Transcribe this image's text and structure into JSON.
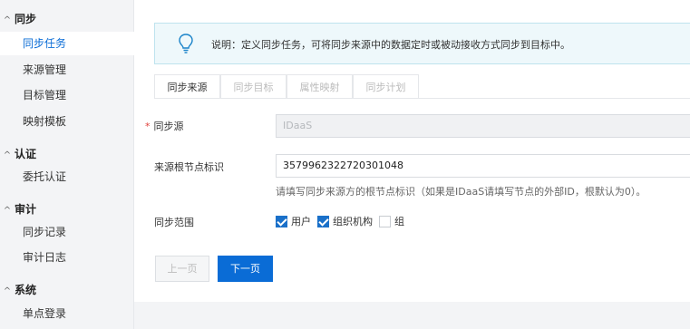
{
  "sidebar": {
    "groups": [
      {
        "title": "同步",
        "items": [
          {
            "label": "同步任务",
            "active": true
          },
          {
            "label": "来源管理"
          },
          {
            "label": "目标管理"
          },
          {
            "label": "映射模板"
          }
        ]
      },
      {
        "title": "认证",
        "items": [
          {
            "label": "委托认证"
          }
        ]
      },
      {
        "title": "审计",
        "items": [
          {
            "label": "同步记录"
          },
          {
            "label": "审计日志"
          }
        ]
      },
      {
        "title": "系统",
        "items": [
          {
            "label": "单点登录"
          }
        ]
      }
    ],
    "caret_icon": "^"
  },
  "notice": {
    "icon": "lightbulb-icon",
    "text": "说明：定义同步任务，可将同步来源中的数据定时或被动接收方式同步到目标中。"
  },
  "tabs": [
    {
      "label": "同步来源",
      "active": true
    },
    {
      "label": "同步目标"
    },
    {
      "label": "属性映射"
    },
    {
      "label": "同步计划"
    }
  ],
  "form": {
    "source": {
      "required_mark": "*",
      "label": "同步源",
      "value": "IDaaS"
    },
    "root_node": {
      "label": "来源根节点标识",
      "value": "3579962322720301048",
      "hint": "请填写同步来源方的根节点标识（如果是IDaaS请填写节点的外部ID，根默认为0）。"
    },
    "scope": {
      "label": "同步范围",
      "options": [
        {
          "label": "用户",
          "checked": true
        },
        {
          "label": "组织机构",
          "checked": true
        },
        {
          "label": "组",
          "checked": false
        }
      ]
    }
  },
  "buttons": {
    "prev": "上一页",
    "next": "下一页"
  },
  "colors": {
    "primary": "#0a6cd6",
    "required": "#e0403a",
    "notice_bg": "#eef8fb"
  }
}
